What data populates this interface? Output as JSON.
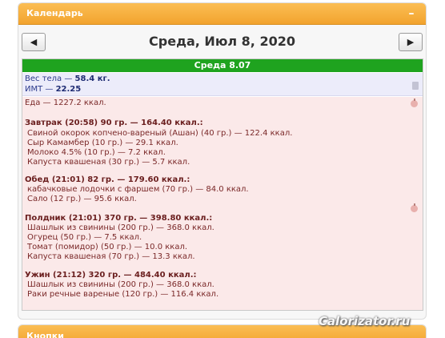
{
  "calendar_panel": {
    "title": "Календарь",
    "collapse_label": "–"
  },
  "nav": {
    "prev_label": "◀",
    "next_label": "▶",
    "date_title": "Среда, Июл 8, 2020"
  },
  "day_bar": "Среда 8.07",
  "body_stats": {
    "weight_label": "Вес тела — ",
    "weight_value": "58.4 кг.",
    "bmi_label": "ИМТ — ",
    "bmi_value": "22.25"
  },
  "food": {
    "total": "Еда — 1227.2 ккал.",
    "meals": [
      {
        "header": "Завтрак (20:58) 90 гр. — 164.40 ккал.:",
        "items": [
          "Свиной окорок копчено-вареный (Ашан) (40 гр.) — 122.4 ккал.",
          "Сыр Камамбер (10 гр.) — 29.1 ккал.",
          "Молоко 4.5% (10 гр.) — 7.2 ккал.",
          "Капуста квашеная (30 гр.) — 5.7 ккал."
        ]
      },
      {
        "header": "Обед (21:01) 82 гр. — 179.60 ккал.:",
        "items": [
          "кабачковые лодочки с фаршем (70 гр.) — 84.0 ккал.",
          "Сало (12 гр.) — 95.6 ккал."
        ]
      },
      {
        "header": "Полдник (21:01) 370 гр. — 398.80 ккал.:",
        "items": [
          "Шашлык из свинины (200 гр.) — 368.0 ккал.",
          "Огурец (50 гр.) — 7.5 ккал.",
          "Томат (помидор) (50 гр.) — 10.0 ккал.",
          "Капуста квашеная (70 гр.) — 13.3 ккал."
        ]
      },
      {
        "header": "Ужин (21:12) 320 гр. — 484.40 ккал.:",
        "items": [
          "Шашлык из свинины (200 гр.) — 368.0 ккал.",
          "Раки речные вареные (120 гр.) — 116.4 ккал."
        ]
      }
    ]
  },
  "next_panel": {
    "title": "Кнопки"
  },
  "watermark": "Calorizator.ru",
  "colors": {
    "header_orange": "#f6ad3a",
    "day_green": "#1fa31f",
    "food_bg": "#fbe9e9",
    "body_bg": "#ececfa"
  },
  "icons": [
    "collapse-icon",
    "scale-icon",
    "apple-icon"
  ]
}
